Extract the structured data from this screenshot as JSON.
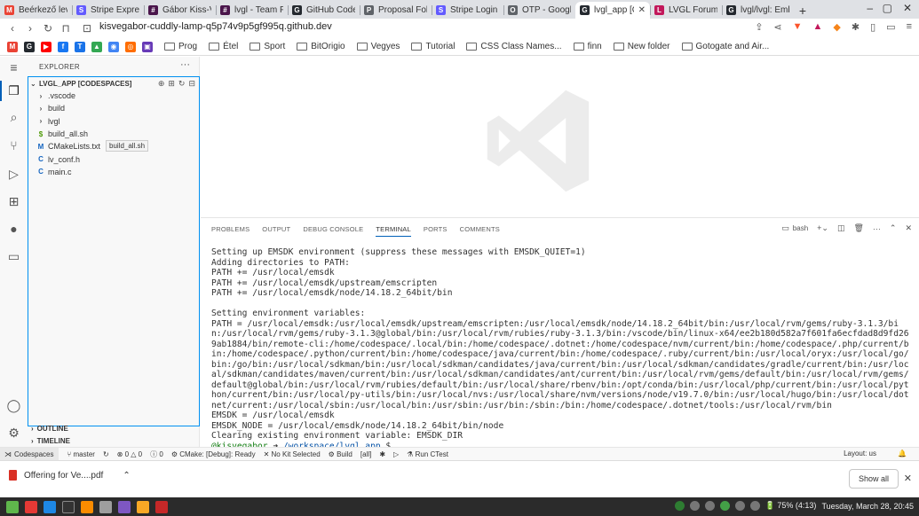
{
  "browser": {
    "tabs": [
      {
        "label": "Beérkező levelek",
        "icon": "gmail-icon",
        "color": "#ea4335",
        "glyph": "M"
      },
      {
        "label": "Stripe Express",
        "icon": "stripe-icon",
        "color": "#635bff",
        "glyph": "S"
      },
      {
        "label": "Gábor Kiss-Vámosi",
        "icon": "slack-icon",
        "color": "#4a154b",
        "glyph": "#"
      },
      {
        "label": "lvgl - Team Flare",
        "icon": "slack-icon",
        "color": "#4a154b",
        "glyph": "#"
      },
      {
        "label": "GitHub Codespaces",
        "icon": "github-icon",
        "color": "#24292f",
        "glyph": "G"
      },
      {
        "label": "Proposal Follow",
        "icon": "doc-icon",
        "color": "#5f6368",
        "glyph": "P"
      },
      {
        "label": "Stripe Login | S",
        "icon": "stripe-icon",
        "color": "#635bff",
        "glyph": "S"
      },
      {
        "label": "OTP - Google D",
        "icon": "doc-icon",
        "color": "#5f6368",
        "glyph": "O"
      },
      {
        "label": "lvgl_app [C",
        "icon": "github-icon",
        "color": "#24292f",
        "glyph": "G",
        "active": true
      },
      {
        "label": "LVGL Forum - C",
        "icon": "lvgl-icon",
        "color": "#c2185b",
        "glyph": "L"
      },
      {
        "label": "lvgl/lvgl: Embe",
        "icon": "github-icon",
        "color": "#24292f",
        "glyph": "G"
      }
    ],
    "url": "kisvegabor-cuddly-lamp-q5p74v9p5gf995q.github.dev",
    "bookmarks": [
      "Prog",
      "Étel",
      "Sport",
      "BitOrigio",
      "Vegyes",
      "Tutorial",
      "CSS Class Names...",
      "finn",
      "New folder",
      "Gotogate and Air..."
    ]
  },
  "vscode": {
    "explorer_title": "EXPLORER",
    "workspace": "LVGL_APP [CODESPACES]",
    "files": [
      {
        "name": ".vscode",
        "kind": "folder"
      },
      {
        "name": "build",
        "kind": "folder"
      },
      {
        "name": "lvgl",
        "kind": "folder"
      },
      {
        "name": "build_all.sh",
        "kind": "sh"
      },
      {
        "name": "CMakeLists.txt",
        "kind": "cmake"
      },
      {
        "name": "lv_conf.h",
        "kind": "c"
      },
      {
        "name": "main.c",
        "kind": "c"
      }
    ],
    "hover_tooltip": "build_all.sh",
    "outline": "OUTLINE",
    "timeline": "TIMELINE",
    "panel_tabs": [
      "PROBLEMS",
      "OUTPUT",
      "DEBUG CONSOLE",
      "TERMINAL",
      "PORTS",
      "COMMENTS"
    ],
    "active_panel_tab": "TERMINAL",
    "terminal_shell": "bash",
    "terminal": {
      "lines": [
        "Setting up EMSDK environment (suppress these messages with EMSDK_QUIET=1)",
        "Adding directories to PATH:",
        "PATH += /usr/local/emsdk",
        "PATH += /usr/local/emsdk/upstream/emscripten",
        "PATH += /usr/local/emsdk/node/14.18.2_64bit/bin",
        "",
        "Setting environment variables:",
        "PATH = /usr/local/emsdk:/usr/local/emsdk/upstream/emscripten:/usr/local/emsdk/node/14.18.2_64bit/bin:/usr/local/rvm/gems/ruby-3.1.3/bin:/usr/local/rvm/gems/ruby-3.1.3@global/bin:/usr/local/rvm/rubies/ruby-3.1.3/bin:/vscode/bin/linux-x64/ee2b180d582a7f601fa6ecfdad8d9fd269ab1884/bin/remote-cli:/home/codespace/.local/bin:/home/codespace/.dotnet:/home/codespace/nvm/current/bin:/home/codespace/.php/current/bin:/home/codespace/.python/current/bin:/home/codespace/java/current/bin:/home/codespace/.ruby/current/bin:/usr/local/oryx:/usr/local/go/bin:/go/bin:/usr/local/sdkman/bin:/usr/local/sdkman/candidates/java/current/bin:/usr/local/sdkman/candidates/gradle/current/bin:/usr/local/sdkman/candidates/maven/current/bin:/usr/local/sdkman/candidates/ant/current/bin:/usr/local/rvm/gems/default/bin:/usr/local/rvm/gems/default@global/bin:/usr/local/rvm/rubies/default/bin:/usr/local/share/rbenv/bin:/opt/conda/bin:/usr/local/php/current/bin:/usr/local/python/current/bin:/usr/local/py-utils/bin:/usr/local/nvs:/usr/local/share/nvm/versions/node/v19.7.0/bin:/usr/local/hugo/bin:/usr/local/dotnet/current:/usr/local/sbin:/usr/local/bin:/usr/sbin:/usr/bin:/sbin:/bin:/home/codespace/.dotnet/tools:/usr/local/rvm/bin",
        "EMSDK = /usr/local/emsdk",
        "EMSDK_NODE = /usr/local/emsdk/node/14.18.2_64bit/bin/node",
        "Clearing existing environment variable: EMSDK_DIR"
      ],
      "prompt_user": "@kisvegabor",
      "prompt_arrow": "➜",
      "prompt_path": "/workspace/lvgl_app",
      "prompt_symbol": "$"
    }
  },
  "statusbar": {
    "remote": "Codespaces",
    "branch": "master",
    "errors": "0",
    "warnings": "0",
    "info": "0",
    "cmake": "CMake: [Debug]: Ready",
    "kit": "No Kit Selected",
    "build": "Build",
    "target": "[all]",
    "run": "Run CTest",
    "layout": "Layout: us"
  },
  "download": {
    "file": "Offering for Ve....pdf",
    "show_all": "Show all"
  },
  "taskbar": {
    "battery": "75% (4:13)",
    "datetime": "Tuesday, March 28, 20:45"
  },
  "colors": {
    "accent": "#005fb8",
    "focus_border": "#0090f1",
    "prompt_user": "#107c10",
    "prompt_path": "#0451a5"
  }
}
